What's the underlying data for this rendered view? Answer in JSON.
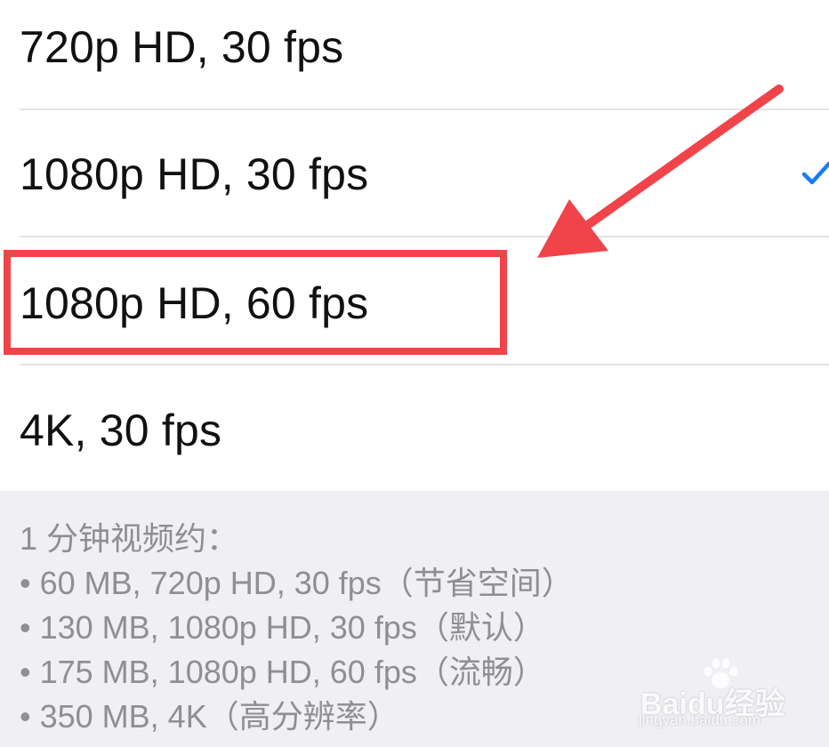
{
  "options": [
    {
      "label": "720p HD, 30 fps",
      "selected": false
    },
    {
      "label": "1080p HD, 30 fps",
      "selected": true
    },
    {
      "label": "1080p HD, 60 fps",
      "selected": false
    },
    {
      "label": "4K, 30 fps",
      "selected": false
    }
  ],
  "footer": {
    "heading": "1 分钟视频约：",
    "lines": [
      "• 60 MB, 720p HD, 30 fps（节省空间）",
      "• 130 MB, 1080p HD, 30 fps（默认）",
      "• 175 MB, 1080p HD, 60 fps（流畅）",
      "• 350 MB, 4K（高分辨率）"
    ]
  },
  "watermark": {
    "brand": "Baidu经验",
    "url": "jingyan.baidu.com"
  },
  "colors": {
    "checkmark": "#1a7cf5",
    "annotation": "#f0444a",
    "footer_background": "#efeff4",
    "footer_text": "#8e8e93"
  },
  "icons": {
    "checkmark": "checkmark-icon",
    "arrow": "annotation-arrow",
    "watermark": "baidu-paw-icon"
  }
}
